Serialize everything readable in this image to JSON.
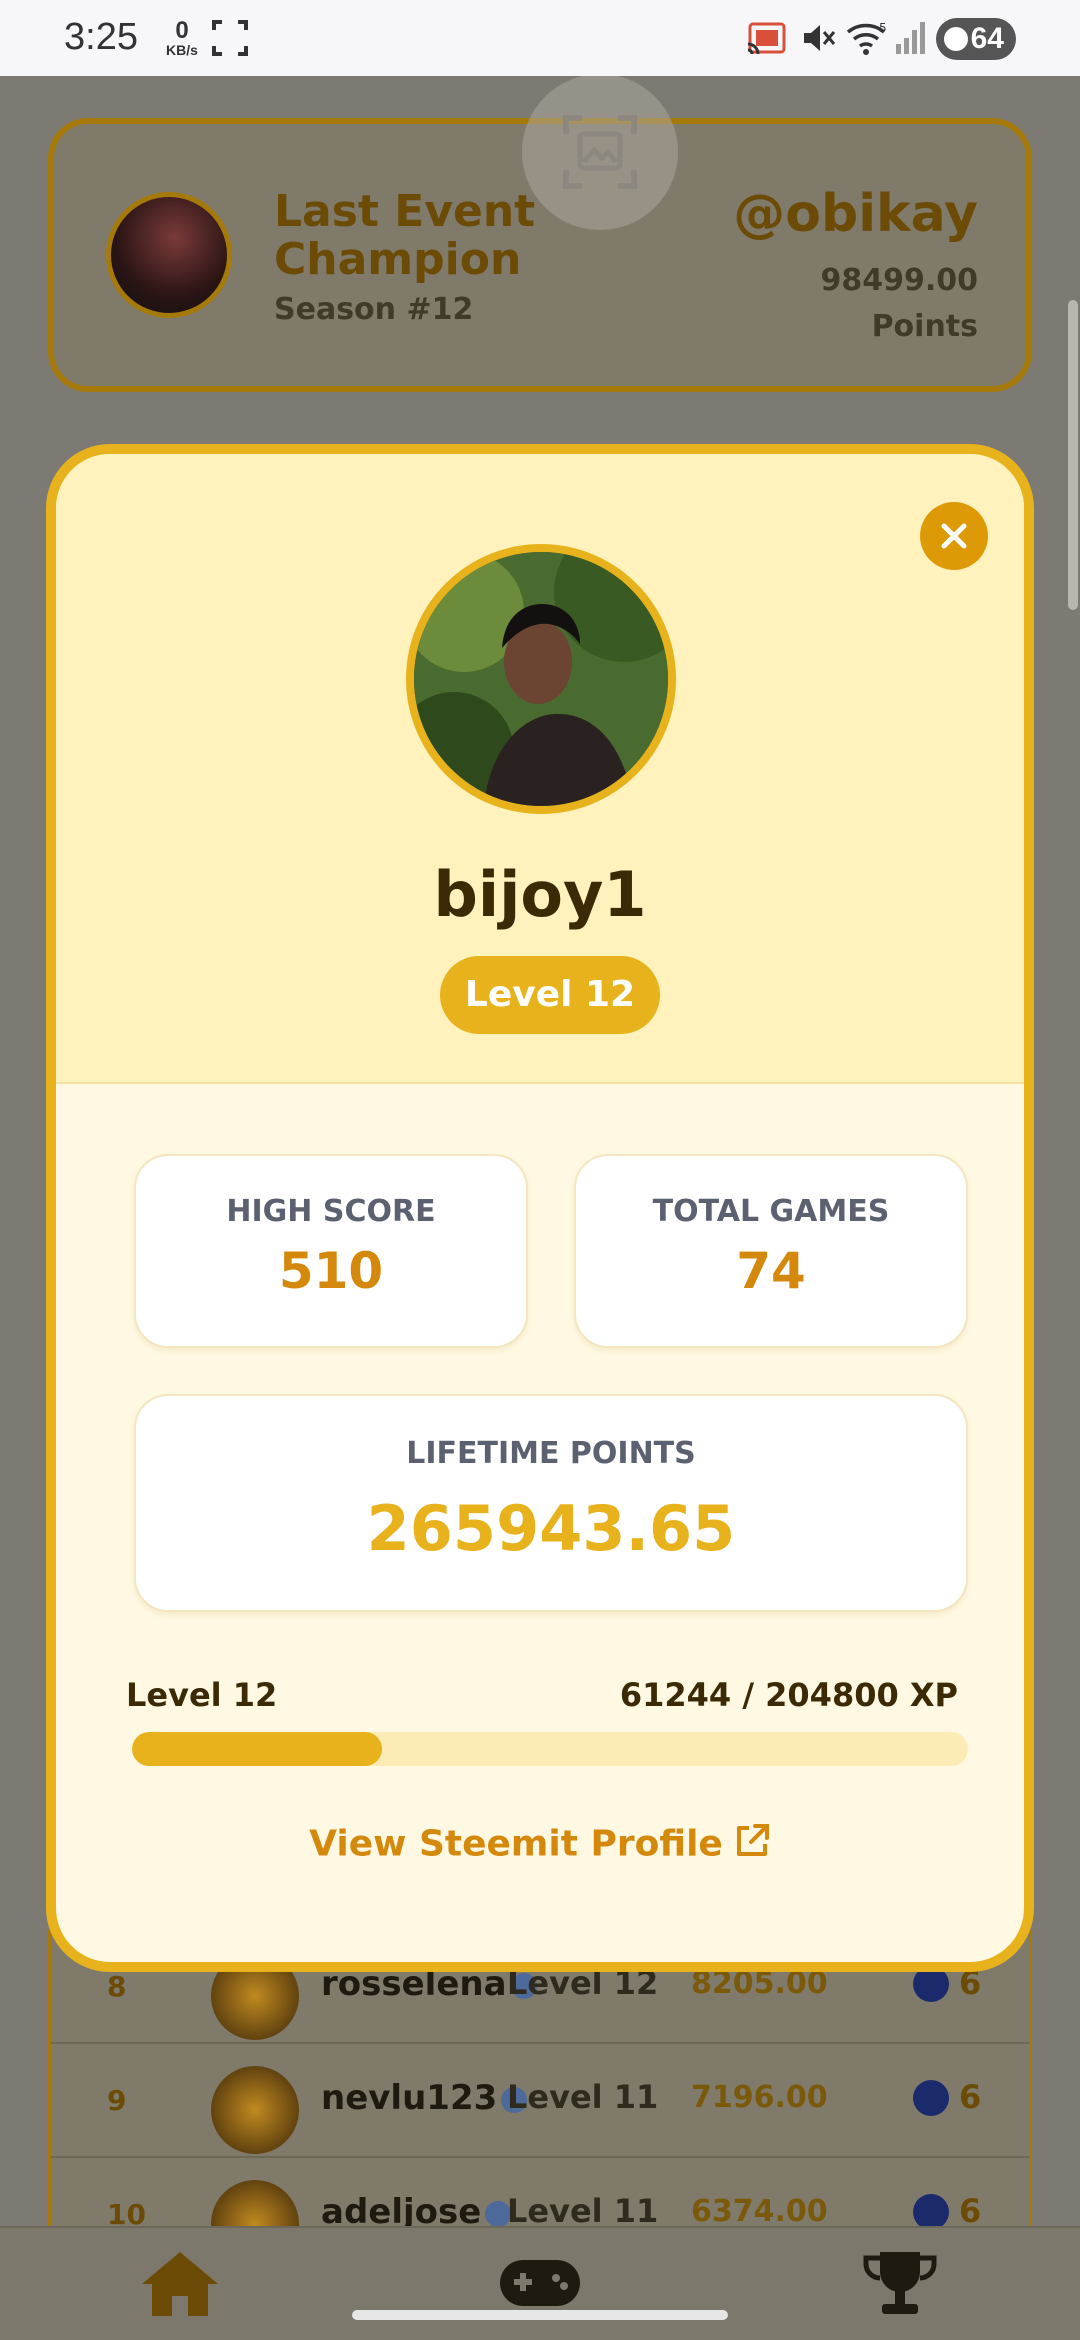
{
  "status_bar": {
    "time": "3:25",
    "net_speed_value": "0",
    "net_speed_unit": "KB/s",
    "wifi_badge": "5",
    "battery": "64"
  },
  "champion": {
    "title": "Last Event Champion",
    "season": "Season #12",
    "handle": "@obikay",
    "points_value": "98499.00",
    "points_label": "Points"
  },
  "leaderboard": {
    "rows": [
      {
        "rank": "8",
        "name": "rosselena",
        "level": "Level 12",
        "points": "8205.00",
        "count": "6"
      },
      {
        "rank": "9",
        "name": "nevlu123",
        "level": "Level 11",
        "points": "7196.00",
        "count": "6"
      },
      {
        "rank": "10",
        "name": "adeljose",
        "level": "Level 11",
        "points": "6374.00",
        "count": "6"
      }
    ]
  },
  "profile": {
    "username": "bijoy1",
    "level_badge": "Level 12",
    "high_score_label": "HIGH SCORE",
    "high_score": "510",
    "total_games_label": "TOTAL GAMES",
    "total_games": "74",
    "lifetime_points_label": "LIFETIME POINTS",
    "lifetime_points": "265943.65",
    "xp_level": "Level 12",
    "xp_text": "61244 / 204800 XP",
    "xp_progress": 0.299,
    "steemit_link": "View Steemit Profile"
  },
  "colors": {
    "accent": "#e8b21c",
    "accent_dark": "#d4890c",
    "text_dark": "#3b2a05"
  },
  "nav": {
    "items": [
      "home-icon",
      "gamepad-icon",
      "trophy-icon"
    ]
  }
}
